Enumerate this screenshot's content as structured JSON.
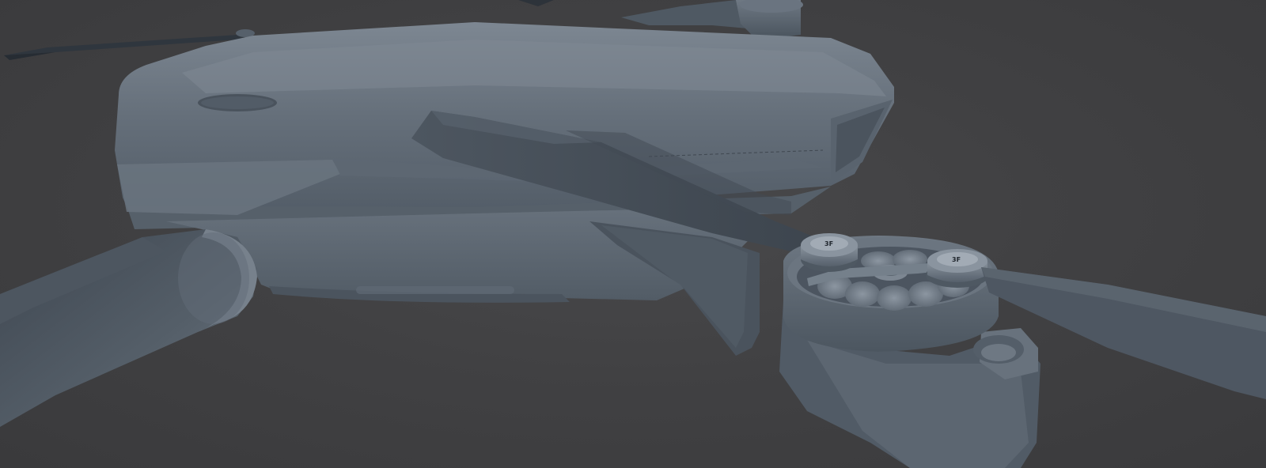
{
  "scene": {
    "background_color": "#404042",
    "model_color": "#5b6570",
    "motor_badge_left": "3F",
    "motor_badge_right": "3F"
  }
}
